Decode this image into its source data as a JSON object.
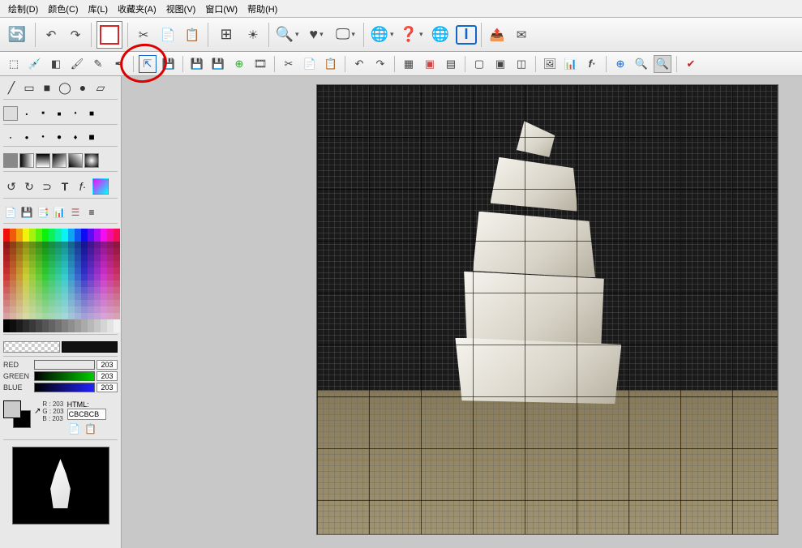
{
  "menu": {
    "draw": "绘制(D)",
    "color": "颜色(C)",
    "library": "库(L)",
    "favorites": "收藏夹(A)",
    "view": "视图(V)",
    "window": "窗口(W)",
    "help": "帮助(H)"
  },
  "rgb": {
    "red_label": "RED",
    "green_label": "GREEN",
    "blue_label": "BLUE",
    "red_value": "203",
    "green_value": "203",
    "blue_value": "203"
  },
  "color_info": {
    "r_line": "R : 203",
    "g_line": "G : 203",
    "b_line": "B : 203",
    "html_label": "HTML:",
    "html_value": "CBCBCB"
  },
  "colors": {
    "foreground": "#cbcbcb",
    "background": "#000000",
    "red_slider": "#d33",
    "green_slider": "#3a8a3a",
    "blue_slider": "#3a5fbf"
  }
}
